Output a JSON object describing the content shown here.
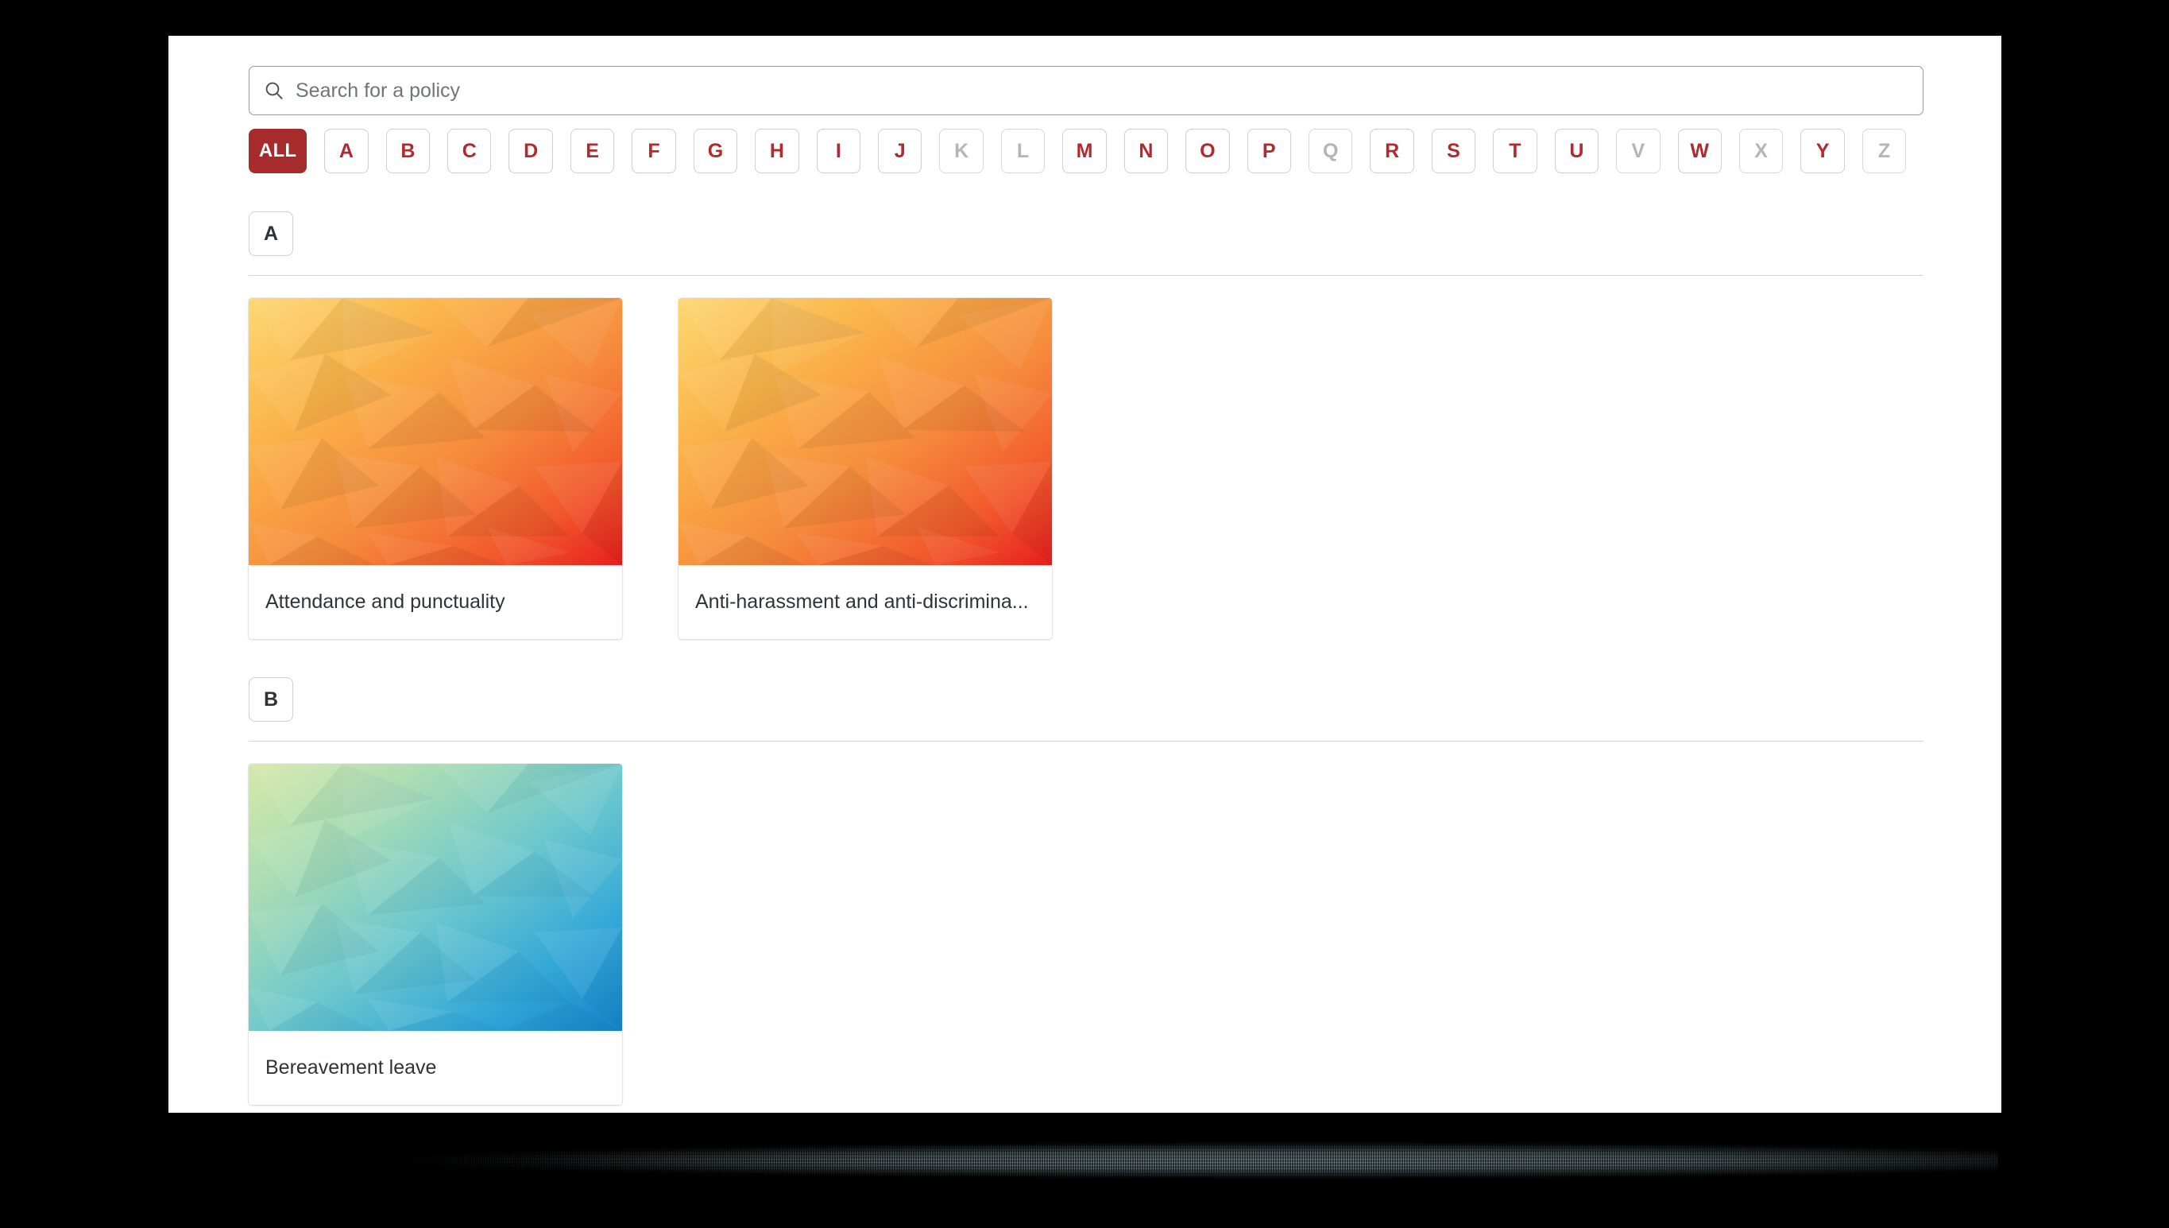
{
  "theme": {
    "accent_red": "#a62b2b",
    "letter_red": "#b02a2f",
    "disabled_gray": "#b5b5b5",
    "text_dark": "#2f3439",
    "border_gray": "#cfcfcf",
    "rule_gray": "#d4d4d4",
    "screen_bg": "#ffffff",
    "frame_black": "#000000"
  },
  "search": {
    "icon": "search-icon",
    "placeholder": "Search for a policy",
    "value": ""
  },
  "alpha_filter": {
    "selected": "ALL",
    "buttons": [
      {
        "label": "ALL",
        "active": true,
        "disabled": false
      },
      {
        "label": "A",
        "active": false,
        "disabled": false
      },
      {
        "label": "B",
        "active": false,
        "disabled": false
      },
      {
        "label": "C",
        "active": false,
        "disabled": false
      },
      {
        "label": "D",
        "active": false,
        "disabled": false
      },
      {
        "label": "E",
        "active": false,
        "disabled": false
      },
      {
        "label": "F",
        "active": false,
        "disabled": false
      },
      {
        "label": "G",
        "active": false,
        "disabled": false
      },
      {
        "label": "H",
        "active": false,
        "disabled": false
      },
      {
        "label": "I",
        "active": false,
        "disabled": false
      },
      {
        "label": "J",
        "active": false,
        "disabled": false
      },
      {
        "label": "K",
        "active": false,
        "disabled": true
      },
      {
        "label": "L",
        "active": false,
        "disabled": true
      },
      {
        "label": "M",
        "active": false,
        "disabled": false
      },
      {
        "label": "N",
        "active": false,
        "disabled": false
      },
      {
        "label": "O",
        "active": false,
        "disabled": false
      },
      {
        "label": "P",
        "active": false,
        "disabled": false
      },
      {
        "label": "Q",
        "active": false,
        "disabled": true
      },
      {
        "label": "R",
        "active": false,
        "disabled": false
      },
      {
        "label": "S",
        "active": false,
        "disabled": false
      },
      {
        "label": "T",
        "active": false,
        "disabled": false
      },
      {
        "label": "U",
        "active": false,
        "disabled": false
      },
      {
        "label": "V",
        "active": false,
        "disabled": true
      },
      {
        "label": "W",
        "active": false,
        "disabled": false
      },
      {
        "label": "X",
        "active": false,
        "disabled": true
      },
      {
        "label": "Y",
        "active": false,
        "disabled": false
      },
      {
        "label": "Z",
        "active": false,
        "disabled": true
      }
    ]
  },
  "sections": [
    {
      "letter": "A",
      "cards": [
        {
          "title": "Attendance and punctuality",
          "thumb": "warm-polygon-thumbnail"
        },
        {
          "title": "Anti-harassment and anti-discrimina...",
          "thumb": "warm-polygon-thumbnail"
        }
      ]
    },
    {
      "letter": "B",
      "cards": [
        {
          "title": "Bereavement leave",
          "thumb": "cool-polygon-thumbnail"
        }
      ]
    }
  ]
}
